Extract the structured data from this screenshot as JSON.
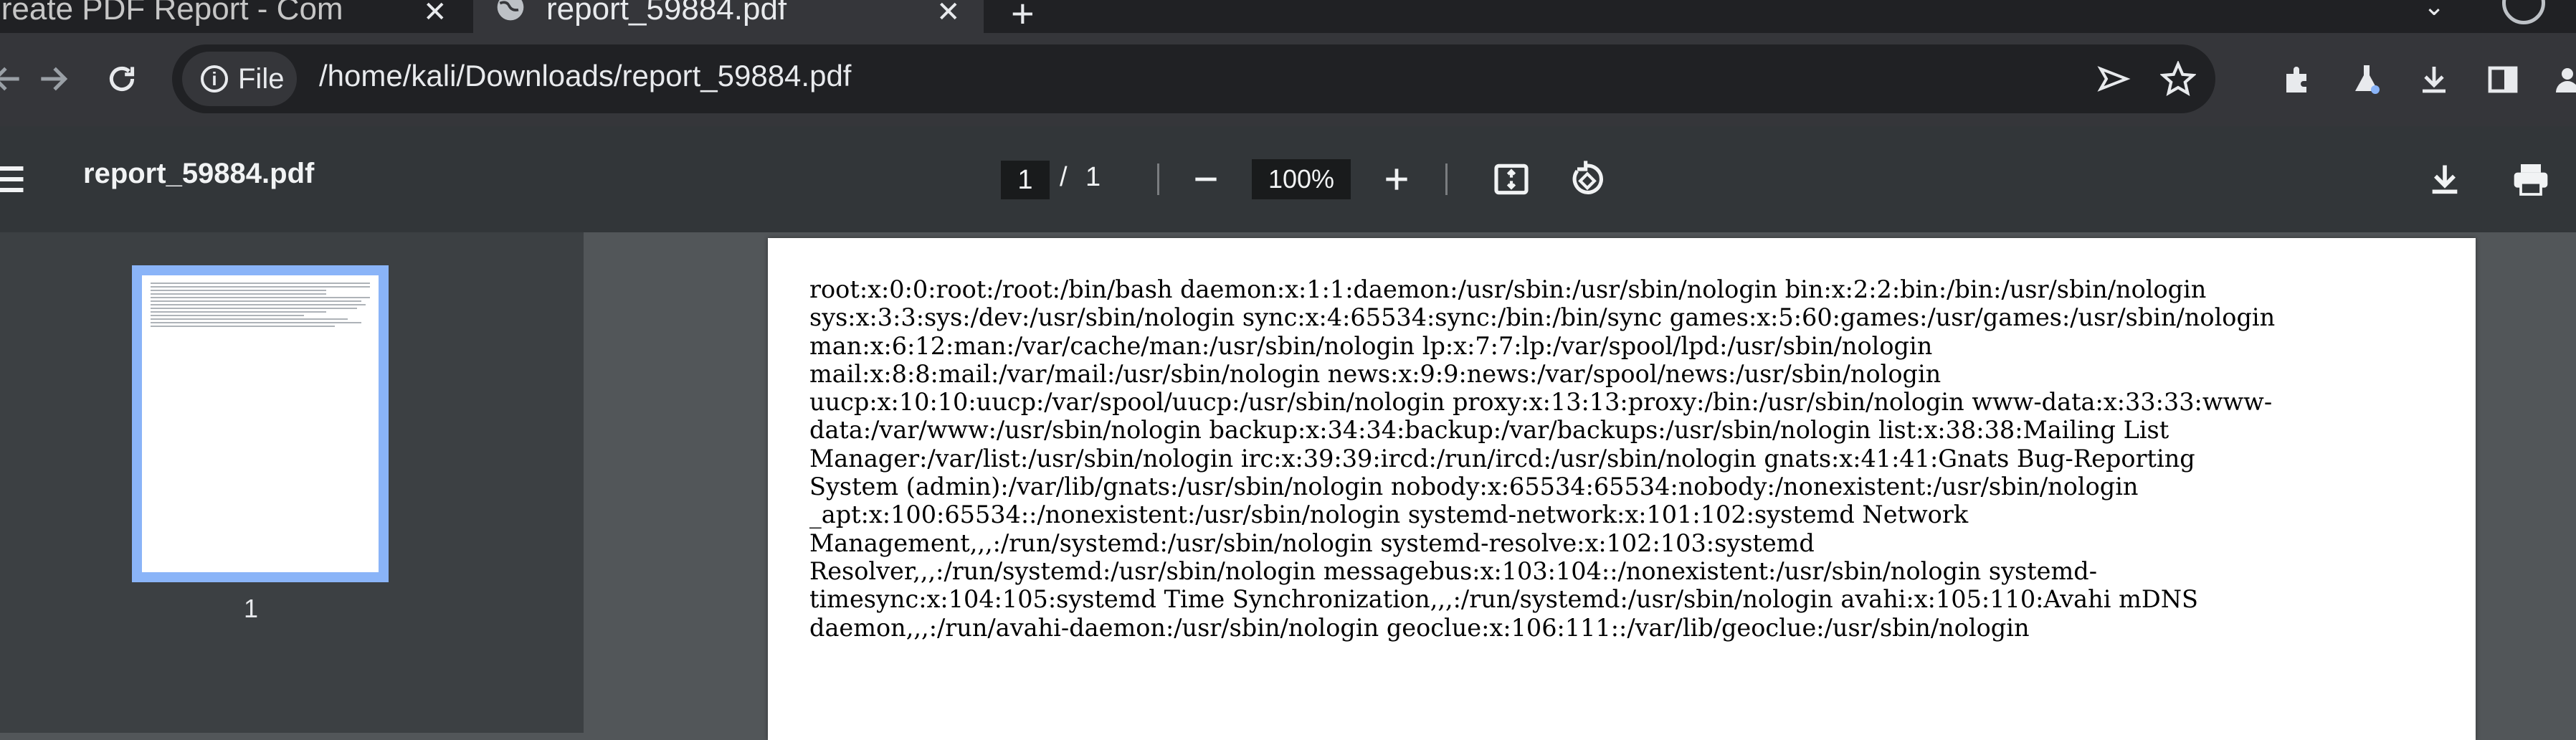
{
  "tabs": [
    {
      "title": "Create PDF Report - Com",
      "close": "✕"
    },
    {
      "title": "report_59884.pdf",
      "close": "✕"
    }
  ],
  "tabstrip": {
    "new_tab": "+",
    "tab_search": "⌄"
  },
  "address_bar": {
    "site_chip_label": "File",
    "url": "/home/kali/Downloads/report_59884.pdf"
  },
  "pdf_toolbar": {
    "title": "report_59884.pdf",
    "page_current": "1",
    "page_separator": "/",
    "page_total": "1",
    "zoom": "100%"
  },
  "sidebar": {
    "thumbnail_label": "1"
  },
  "document": {
    "lines": [
      "root:x:0:0:root:/root:/bin/bash daemon:x:1:1:daemon:/usr/sbin:/usr/sbin/nologin bin:x:2:2:bin:/bin:/usr/sbin/nologin",
      "sys:x:3:3:sys:/dev:/usr/sbin/nologin sync:x:4:65534:sync:/bin:/bin/sync games:x:5:60:games:/usr/games:/usr/sbin/nologin",
      "man:x:6:12:man:/var/cache/man:/usr/sbin/nologin lp:x:7:7:lp:/var/spool/lpd:/usr/sbin/nologin",
      "mail:x:8:8:mail:/var/mail:/usr/sbin/nologin news:x:9:9:news:/var/spool/news:/usr/sbin/nologin",
      "uucp:x:10:10:uucp:/var/spool/uucp:/usr/sbin/nologin proxy:x:13:13:proxy:/bin:/usr/sbin/nologin www-data:x:33:33:www-",
      "data:/var/www:/usr/sbin/nologin backup:x:34:34:backup:/var/backups:/usr/sbin/nologin list:x:38:38:Mailing List",
      "Manager:/var/list:/usr/sbin/nologin irc:x:39:39:ircd:/run/ircd:/usr/sbin/nologin gnats:x:41:41:Gnats Bug-Reporting",
      "System (admin):/var/lib/gnats:/usr/sbin/nologin nobody:x:65534:65534:nobody:/nonexistent:/usr/sbin/nologin",
      "_apt:x:100:65534::/nonexistent:/usr/sbin/nologin systemd-network:x:101:102:systemd Network",
      "Management,,,:/run/systemd:/usr/sbin/nologin systemd-resolve:x:102:103:systemd",
      "Resolver,,,:/run/systemd:/usr/sbin/nologin messagebus:x:103:104::/nonexistent:/usr/sbin/nologin systemd-",
      "timesync:x:104:105:systemd Time Synchronization,,,:/run/systemd:/usr/sbin/nologin avahi:x:105:110:Avahi mDNS",
      "daemon,,,:/run/avahi-daemon:/usr/sbin/nologin geoclue:x:106:111::/var/lib/geoclue:/usr/sbin/nologin"
    ]
  }
}
